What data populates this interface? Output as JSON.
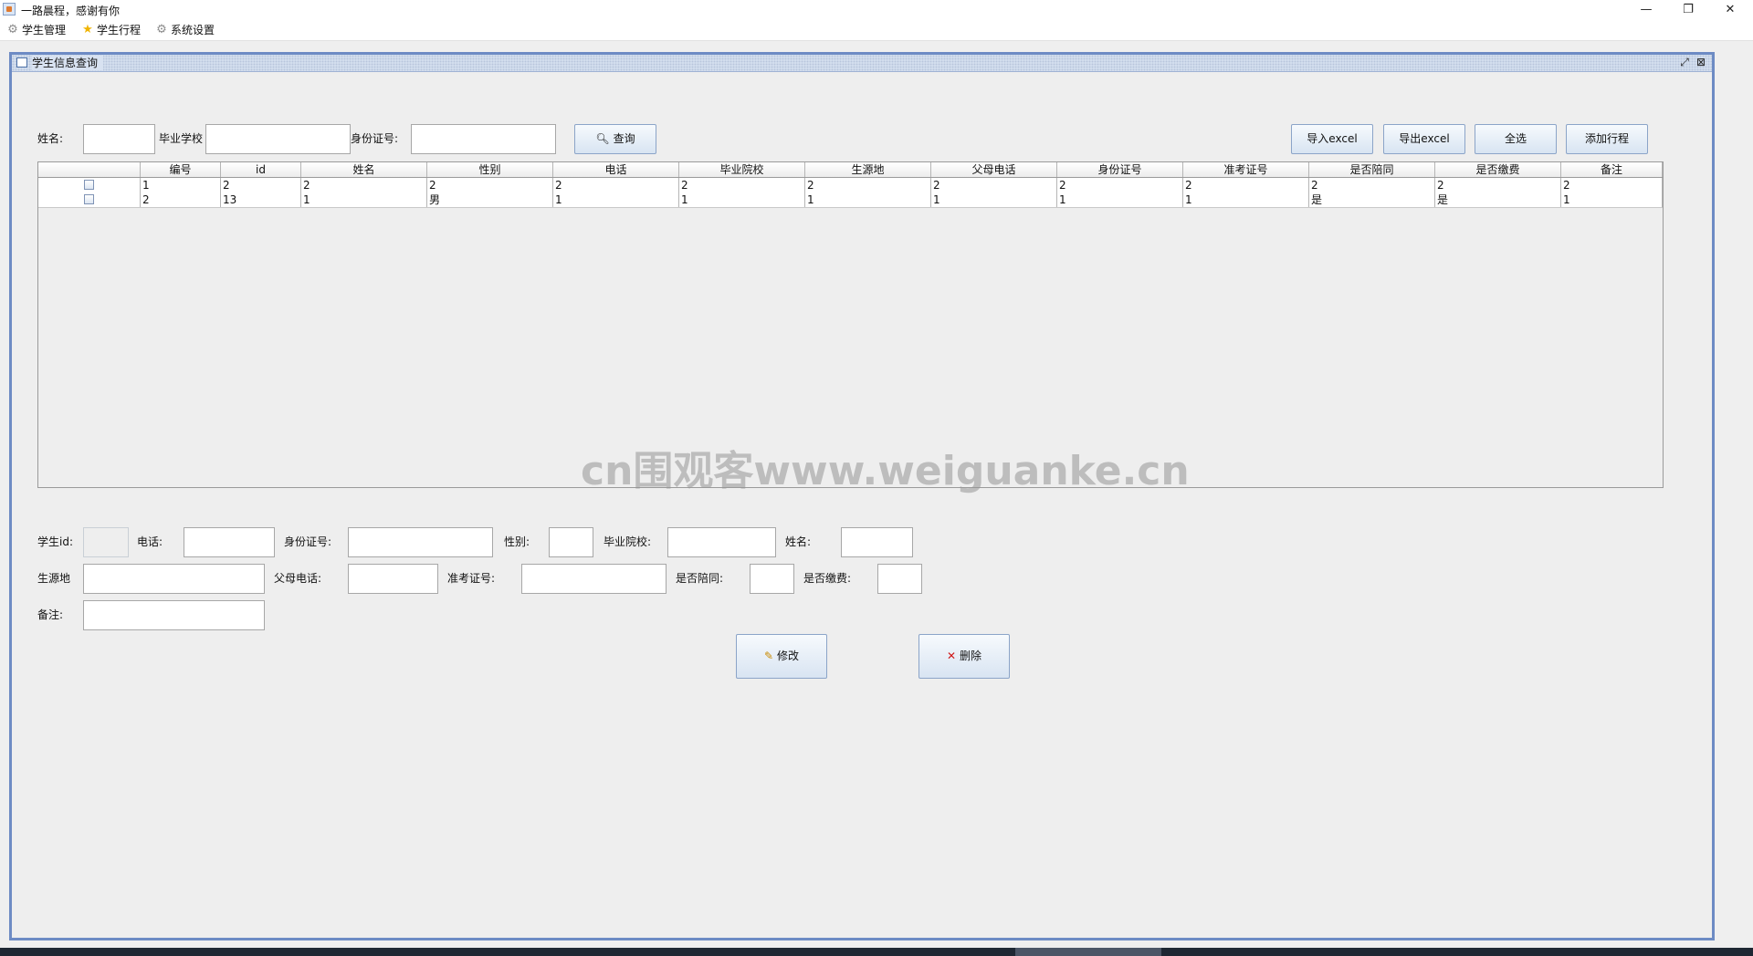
{
  "window": {
    "title": "一路晨程，感谢有你",
    "controls": {
      "minimize": "—",
      "restore": "❐",
      "close": "✕"
    }
  },
  "menu": [
    {
      "label": "学生管理",
      "icon": "gear-icon",
      "glyph": "⚙"
    },
    {
      "label": "学生行程",
      "icon": "star-icon",
      "glyph": "★"
    },
    {
      "label": "系统设置",
      "icon": "gear-icon",
      "glyph": "⚙"
    }
  ],
  "frame": {
    "title": "学生信息查询",
    "controls": {
      "restore": "⤢",
      "close": "⊠"
    }
  },
  "search": {
    "name_label": "姓名:",
    "school_label": "毕业学校",
    "idcard_label": "身份证号:",
    "name_value": "",
    "school_value": "",
    "idcard_value": "",
    "query_button": "查询",
    "import_button": "导入excel",
    "export_button": "导出excel",
    "select_all_button": "全选",
    "add_trip_button": "添加行程"
  },
  "table": {
    "columns": [
      "",
      "编号",
      "id",
      "姓名",
      "性别",
      "电话",
      "毕业院校",
      "生源地",
      "父母电话",
      "身份证号",
      "准考证号",
      "是否陪同",
      "是否缴费",
      "备注"
    ],
    "rows": [
      {
        "checked": false,
        "cells": [
          "1",
          "2",
          "2",
          "2",
          "2",
          "2",
          "2",
          "2",
          "2",
          "2",
          "2",
          "2",
          "2"
        ]
      },
      {
        "checked": false,
        "cells": [
          "2",
          "13",
          "1",
          "男",
          "1",
          "1",
          "1",
          "1",
          "1",
          "1",
          "是",
          "是",
          "1"
        ]
      }
    ]
  },
  "detail": {
    "student_id_label": "学生id:",
    "phone_label": "电话:",
    "idcard_label": "身份证号:",
    "gender_label": "性别:",
    "school_label": "毕业院校:",
    "name_label": "姓名:",
    "origin_label": "生源地",
    "parent_phone_label": "父母电话:",
    "exam_no_label": "准考证号:",
    "accompany_label": "是否陪同:",
    "paid_label": "是否缴费:",
    "note_label": "备注:",
    "modify_button": "修改",
    "delete_button": "删除"
  },
  "watermark": "cn围观客www.weiguanke.cn"
}
